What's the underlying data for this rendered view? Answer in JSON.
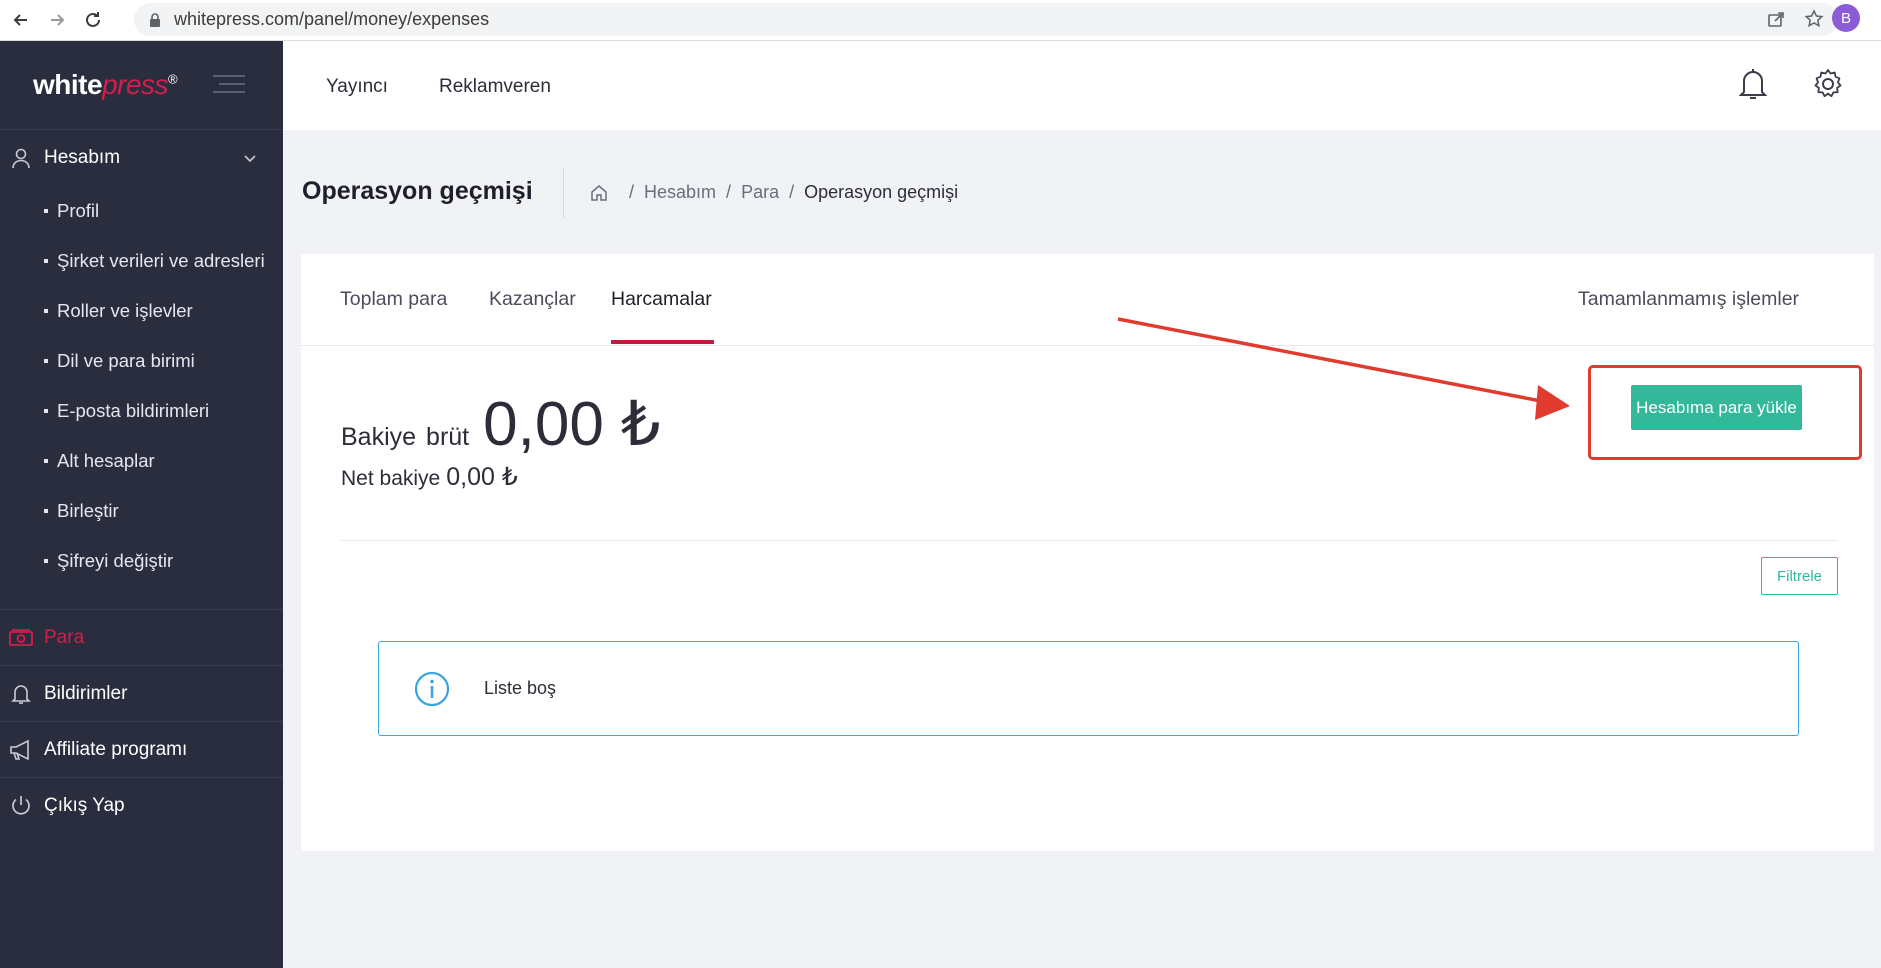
{
  "browser": {
    "url": "whitepress.com/panel/money/expenses",
    "profile_initial": "B"
  },
  "sidebar": {
    "logo_main": "white",
    "logo_accent": "press",
    "logo_reg": "®",
    "account_label": "Hesabım",
    "sub_items": [
      {
        "label": "Profil"
      },
      {
        "label": "Şirket verileri ve adresleri"
      },
      {
        "label": "Roller ve işlevler"
      },
      {
        "label": "Dil ve para birimi"
      },
      {
        "label": "E-posta bildirimleri"
      },
      {
        "label": "Alt hesaplar"
      },
      {
        "label": "Birleştir"
      },
      {
        "label": "Şifreyi değiştir"
      }
    ],
    "items": [
      {
        "label": "Para"
      },
      {
        "label": "Bildirimler"
      },
      {
        "label": "Affiliate programı"
      },
      {
        "label": "Çıkış Yap"
      }
    ]
  },
  "topbar": {
    "nav_publisher": "Yayıncı",
    "nav_advertiser": "Reklamveren"
  },
  "page": {
    "title": "Operasyon geçmişi",
    "breadcrumb": [
      "Hesabım",
      "Para",
      "Operasyon geçmişi"
    ]
  },
  "tabs": {
    "total": "Toplam para",
    "earnings": "Kazançlar",
    "expenses": "Harcamalar",
    "incomplete": "Tamamlanmamış işlemler"
  },
  "balance": {
    "label_balance": "Bakiye",
    "label_gross": "brüt",
    "gross_amount": "0,00 ₺",
    "label_net": "Net bakiye",
    "net_amount": "0,00 ₺"
  },
  "buttons": {
    "topup": "Hesabıma para yükle",
    "filter": "Filtrele"
  },
  "empty_state": {
    "text": "Liste boş"
  },
  "colors": {
    "sidebar_bg": "#2a2d3e",
    "accent_red": "#d11f4b",
    "primary_green": "#33b89a",
    "info_blue": "#3aa3e0",
    "annotation_red": "#e03b2e"
  }
}
